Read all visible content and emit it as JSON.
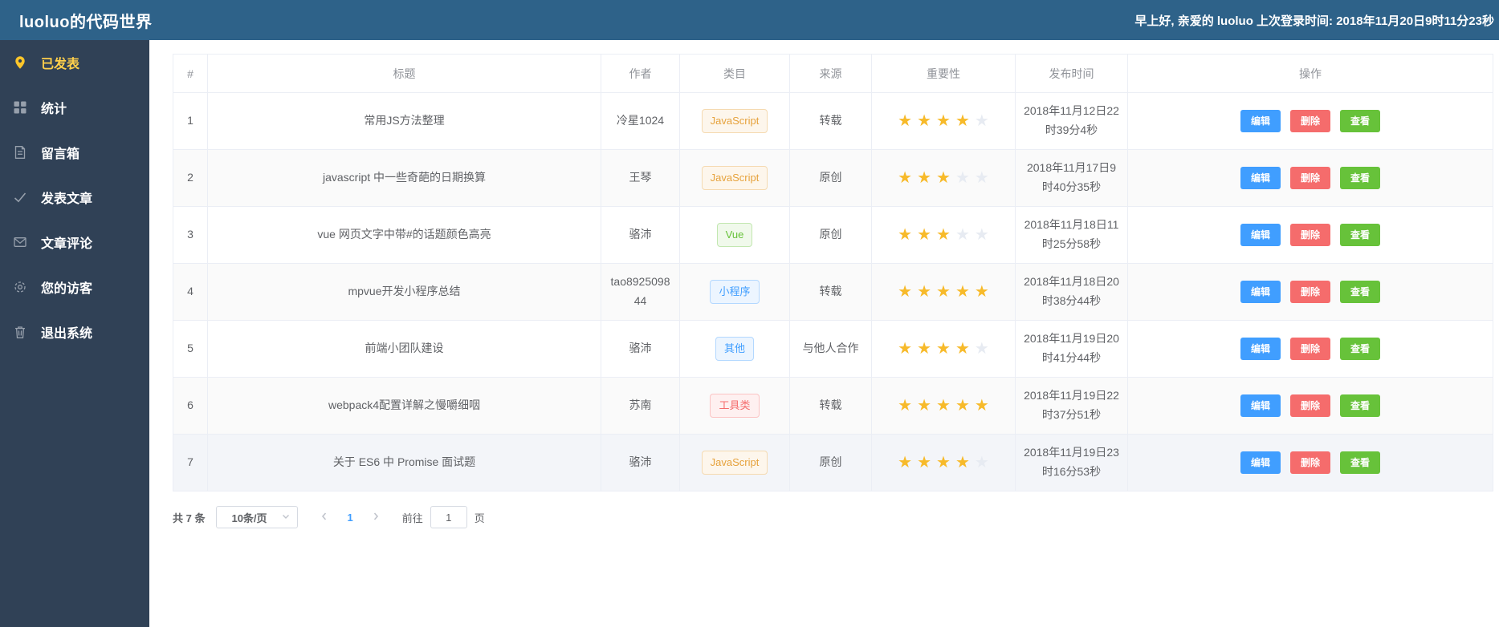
{
  "topbar": {
    "title": "luoluo的代码世界",
    "greeting": "早上好, 亲爱的 luoluo  上次登录时间: 2018年11月20日9时11分23秒"
  },
  "sidebar": {
    "items": [
      {
        "name": "published",
        "icon": "location-pin-icon",
        "label": "已发表",
        "active": true
      },
      {
        "name": "statistics",
        "icon": "grid-icon",
        "label": "统计",
        "active": false
      },
      {
        "name": "message-box",
        "icon": "document-icon",
        "label": "留言箱",
        "active": false
      },
      {
        "name": "post-article",
        "icon": "check-icon",
        "label": "发表文章",
        "active": false
      },
      {
        "name": "article-comments",
        "icon": "envelope-icon",
        "label": "文章评论",
        "active": false
      },
      {
        "name": "your-visitors",
        "icon": "gear-icon",
        "label": "您的访客",
        "active": false
      },
      {
        "name": "logout",
        "icon": "trash-icon",
        "label": "退出系统",
        "active": false
      }
    ]
  },
  "table": {
    "columns": [
      {
        "key": "index",
        "label": "#"
      },
      {
        "key": "title",
        "label": "标题"
      },
      {
        "key": "author",
        "label": "作者"
      },
      {
        "key": "category",
        "label": "类目"
      },
      {
        "key": "source",
        "label": "来源"
      },
      {
        "key": "importance",
        "label": "重要性"
      },
      {
        "key": "published",
        "label": "发布时间"
      },
      {
        "key": "actions",
        "label": "操作"
      }
    ],
    "action_labels": {
      "edit": "编辑",
      "delete": "删除",
      "view": "查看"
    },
    "max_stars": 5,
    "rows": [
      {
        "index": "1",
        "title": "常用JS方法整理",
        "author": "冷星1024",
        "category": {
          "label": "JavaScript",
          "type": "warning"
        },
        "source": "转载",
        "stars": 4,
        "published": "2018年11月12日22时39分4秒"
      },
      {
        "index": "2",
        "title": "javascript 中一些奇葩的日期换算",
        "author": "王琴",
        "category": {
          "label": "JavaScript",
          "type": "warning"
        },
        "source": "原创",
        "stars": 3,
        "published": "2018年11月17日9时40分35秒"
      },
      {
        "index": "3",
        "title": "vue 网页文字中带#的话题颜色高亮",
        "author": "骆沛",
        "category": {
          "label": "Vue",
          "type": "success"
        },
        "source": "原创",
        "stars": 3,
        "published": "2018年11月18日11时25分58秒"
      },
      {
        "index": "4",
        "title": "mpvue开发小程序总结",
        "author": "tao892509844",
        "category": {
          "label": "小程序",
          "type": "primary"
        },
        "source": "转载",
        "stars": 5,
        "published": "2018年11月18日20时38分44秒"
      },
      {
        "index": "5",
        "title": "前端小团队建设",
        "author": "骆沛",
        "category": {
          "label": "其他",
          "type": "primary"
        },
        "source": "与他人合作",
        "stars": 4,
        "published": "2018年11月19日20时41分44秒"
      },
      {
        "index": "6",
        "title": "webpack4配置详解之慢嚼细咽",
        "author": "苏南",
        "category": {
          "label": "工具类",
          "type": "danger"
        },
        "source": "转载",
        "stars": 5,
        "published": "2018年11月19日22时37分51秒"
      },
      {
        "index": "7",
        "title": "关于 ES6 中 Promise 面试题",
        "author": "骆沛",
        "category": {
          "label": "JavaScript",
          "type": "warning"
        },
        "source": "原创",
        "stars": 4,
        "published": "2018年11月19日23时16分53秒"
      }
    ]
  },
  "pagination": {
    "total_label": "共 7 条",
    "page_size_label": "10条/页",
    "current_page": "1",
    "goto_label": "前往",
    "goto_value": "1",
    "goto_suffix": "页"
  },
  "colors": {
    "topbar": "#2e6289",
    "sidebar": "#304156",
    "active_menu": "#ffd04b",
    "primary": "#409eff",
    "success": "#67c23a",
    "warning": "#e6a23c",
    "danger": "#f56c6c",
    "star_filled": "#f7ba2a",
    "star_empty": "#e7ebf2"
  }
}
